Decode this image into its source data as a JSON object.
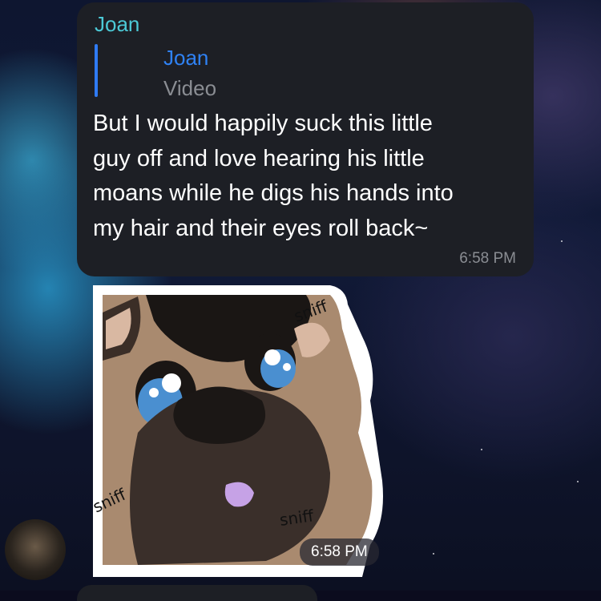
{
  "message": {
    "sender": "Joan",
    "reply": {
      "name": "Joan",
      "type": "Video"
    },
    "lines": [
      "But I would happily suck this little",
      "guy off and love hearing his little",
      "moans while he digs his hands into",
      "my hair and their eyes roll back~"
    ],
    "time": "6:58 PM"
  },
  "sticker": {
    "captions": [
      "sniff",
      "sniff",
      "sniff"
    ],
    "time": "6:58 PM"
  },
  "avatar": {
    "icon": "user-avatar"
  },
  "colors": {
    "bubble": "#1d1f25",
    "sender_name": "#4cc9d6",
    "reply_accent": "#2f7bf5",
    "meta_text": "#8a8d93"
  }
}
